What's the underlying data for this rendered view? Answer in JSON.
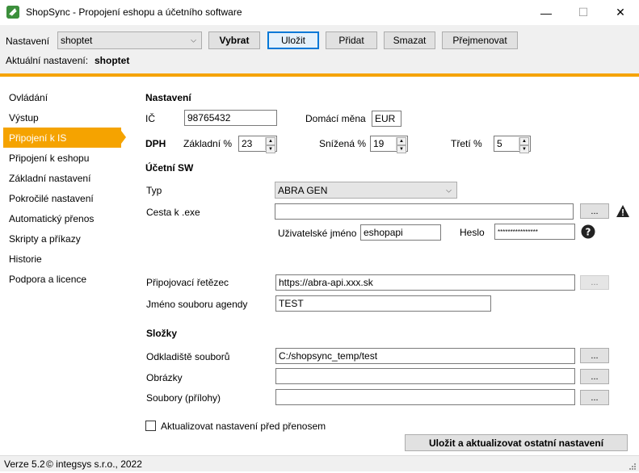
{
  "window": {
    "title": "ShopSync - Propojení eshopu a účetního software",
    "minimize": "—",
    "maximize": "☐",
    "close": "✕"
  },
  "toolbar": {
    "config_label": "Nastavení",
    "config_value": "shoptet",
    "select_button": "Vybrat",
    "save_button": "Uložit",
    "add_button": "Přidat",
    "delete_button": "Smazat",
    "rename_button": "Přejmenovat",
    "current_label": "Aktuální nastavení:",
    "current_value": "shoptet"
  },
  "sidebar": {
    "items": [
      {
        "label": "Ovládání"
      },
      {
        "label": "Výstup"
      },
      {
        "label": "Připojení k IS",
        "active": true
      },
      {
        "label": "Připojení k eshopu"
      },
      {
        "label": "Základní nastavení"
      },
      {
        "label": "Pokročilé nastavení"
      },
      {
        "label": "Automatický přenos"
      },
      {
        "label": "Skripty a příkazy"
      },
      {
        "label": "Historie"
      },
      {
        "label": "Podpora a licence"
      }
    ]
  },
  "settings": {
    "heading": "Nastavení",
    "ic_label": "IČ",
    "ic_value": "98765432",
    "currency_label": "Domácí měna",
    "currency_value": "EUR",
    "vat_label": "DPH",
    "vat_base_label": "Základní %",
    "vat_base_value": "23",
    "vat_reduced_label": "Snížená %",
    "vat_reduced_value": "19",
    "vat_third_label": "Třetí %",
    "vat_third_value": "5"
  },
  "accounting": {
    "heading": "Účetní SW",
    "type_label": "Typ",
    "type_value": "ABRA GEN",
    "exe_label": "Cesta k .exe",
    "exe_value": "",
    "browse": "...",
    "username_label": "Uživatelské jméno",
    "username_value": "eshopapi",
    "password_label": "Heslo",
    "password_value": "****************",
    "connection_label": "Připojovací řetězec",
    "connection_value": "https://abra-api.xxx.sk",
    "agenda_label": "Jméno souboru agendy",
    "agenda_value": "TEST"
  },
  "folders": {
    "heading": "Složky",
    "storage_label": "Odkladiště souborů",
    "storage_value": "C:/shopsync_temp/test",
    "images_label": "Obrázky",
    "images_value": "",
    "attachments_label": "Soubory (přílohy)",
    "attachments_value": ""
  },
  "footer": {
    "update_checkbox_label": "Aktualizovat nastavení před přenosem",
    "save_update_button": "Uložit a aktualizovat ostatní nastavení"
  },
  "status": {
    "version": "Verze 5.2",
    "copyright": "© integsys s.r.o., 2022"
  },
  "colors": {
    "accent": "#f5a300",
    "focus": "#0078d7"
  }
}
